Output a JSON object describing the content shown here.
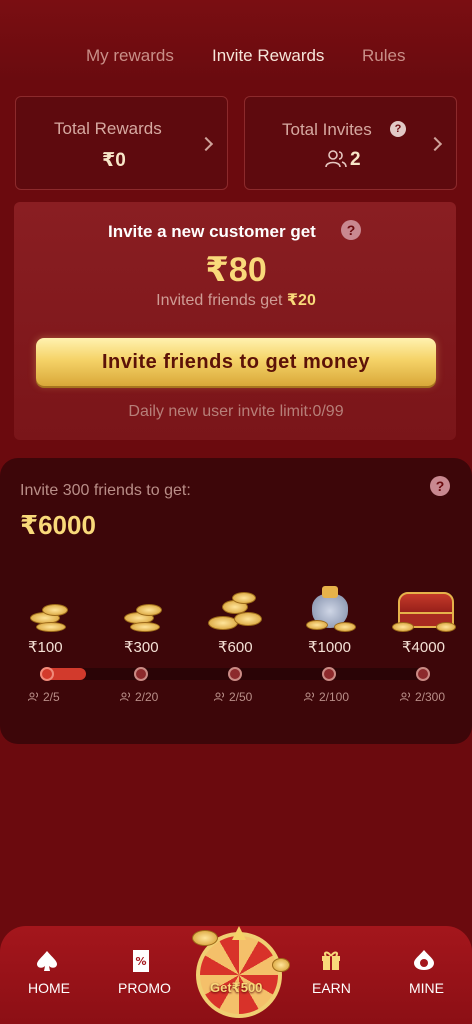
{
  "tabs": {
    "my_rewards": "My rewards",
    "invite_rewards": "Invite Rewards",
    "rules": "Rules",
    "active": "invite_rewards"
  },
  "stats": {
    "total_rewards_label": "Total Rewards",
    "total_rewards_value": "₹0",
    "total_invites_label": "Total Invites",
    "total_invites_value": "2"
  },
  "invite": {
    "headline": "Invite a new customer get",
    "amount": "₹80",
    "friends_text": "Invited friends get ",
    "friends_amount": "₹20",
    "button_label": "Invite friends to get money",
    "limit_text": "Daily new user invite limit:0/99"
  },
  "progress": {
    "title": "Invite 300 friends to get:",
    "total": "₹6000",
    "fill_fraction": 0.4,
    "milestones": [
      {
        "amount": "₹100",
        "count": "2/5"
      },
      {
        "amount": "₹300",
        "count": "2/20"
      },
      {
        "amount": "₹600",
        "count": "2/50"
      },
      {
        "amount": "₹1000",
        "count": "2/100"
      },
      {
        "amount": "₹4000",
        "count": "2/300"
      }
    ]
  },
  "nav": {
    "home": "HOME",
    "promo": "PROMO",
    "get_prefix": "Get",
    "get_amount": "₹500",
    "earn": "EARN",
    "mine": "MINE"
  },
  "colors": {
    "background": "#6b0a0e",
    "gold_button": "#f5d368",
    "progress_fill": "#d23a2c",
    "nav_bar": "#a4161c"
  }
}
